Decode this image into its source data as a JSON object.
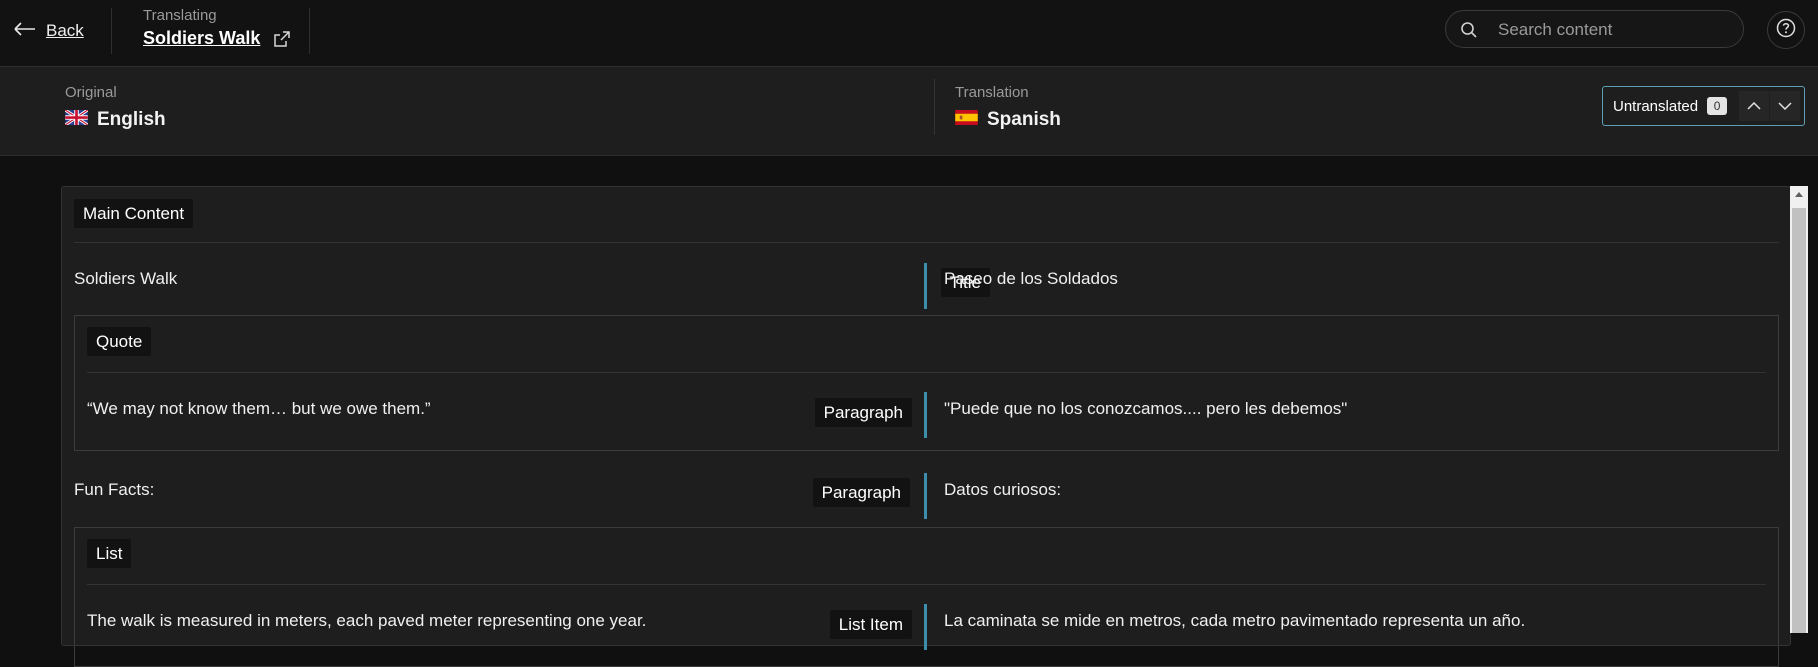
{
  "header": {
    "back_label": "Back",
    "translating_label": "Translating",
    "document_title": "Soldiers Walk",
    "search_placeholder": "Search content"
  },
  "languages": {
    "original_caption": "Original",
    "original_name": "English",
    "translation_caption": "Translation",
    "translation_name": "Spanish"
  },
  "filter": {
    "label": "Untranslated",
    "count": "0"
  },
  "content": {
    "main_section": "Main Content",
    "rows": [
      {
        "source": "Soldiers Walk",
        "type": "Title",
        "target": "Paseo de los Soldados"
      },
      {
        "source": "“We may not know them… but we owe them.”",
        "type": "Paragraph",
        "target": "\"Puede que no los conozcamos.... pero les debemos\""
      },
      {
        "source": "Fun Facts:",
        "type": "Paragraph",
        "target": "Datos curiosos:"
      },
      {
        "source": "The walk is measured in meters, each paved meter representing one year.",
        "type": "List Item",
        "target": "La caminata se mide en metros, cada metro pavimentado representa un año."
      }
    ],
    "quote_section": "Quote",
    "list_section": "List"
  },
  "colors": {
    "accent": "#3d8eab",
    "background": "#101010",
    "panel": "#1e1e1e"
  }
}
